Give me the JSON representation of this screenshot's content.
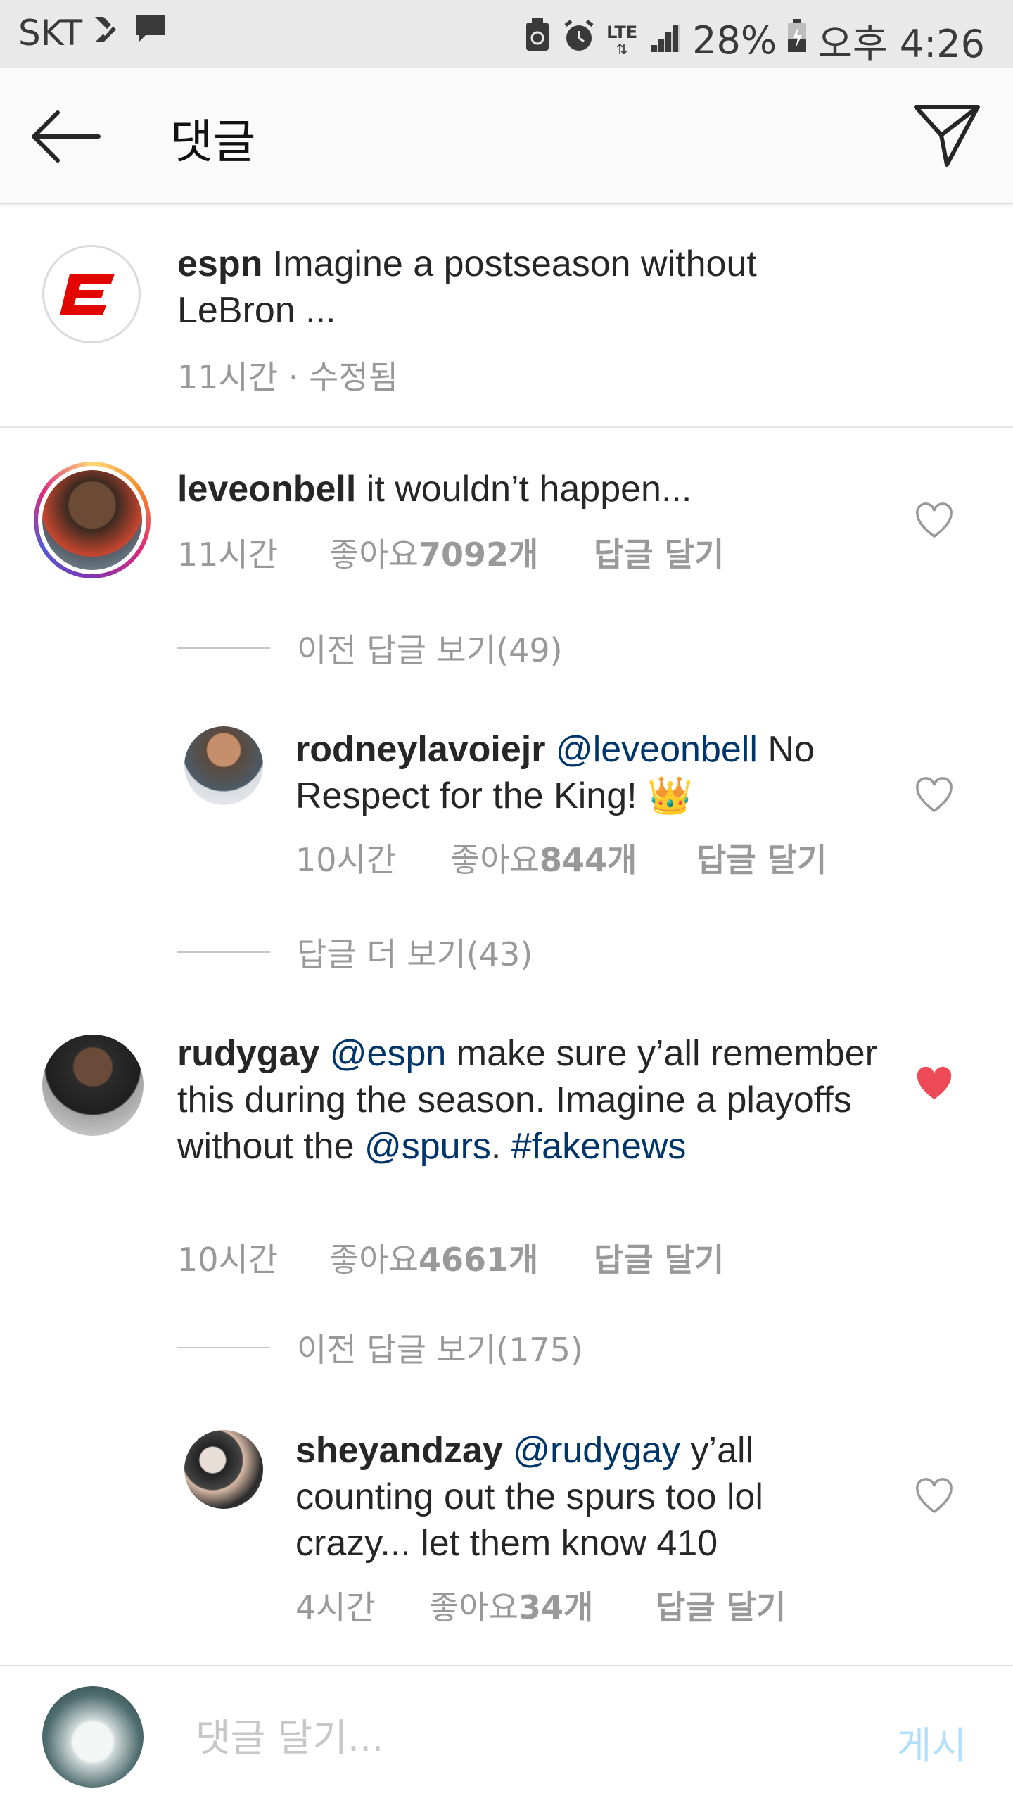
{
  "status_bar": {
    "carrier": "SKT",
    "lte": "LTE",
    "battery": "28%",
    "time": "오후 4:26"
  },
  "app_bar": {
    "title": "댓글"
  },
  "caption": {
    "username": "espn",
    "text": "Imagine a postseason without LeBron ...",
    "meta": "11시간 · 수정됨"
  },
  "comments": [
    {
      "username": "leveonbell",
      "text": "it wouldn’t happen...",
      "time": "11시간",
      "likes_prefix": "좋아요 ",
      "likes": "7092개",
      "reply": "답글 달기",
      "liked": false
    },
    {
      "username": "rodneylavoiejr",
      "mention": "@leveonbell",
      "text": "No Respect for the King! 👑",
      "time": "10시간",
      "likes_prefix": "좋아요 ",
      "likes": "844개",
      "reply": "답글 달기",
      "liked": false
    },
    {
      "username": "rudygay",
      "mention": "@espn",
      "text1": "make sure y’all remember this during the season. Imagine a playoffs without the",
      "mention2": "@spurs",
      "text2": ".",
      "hashtag": "#fakenews",
      "time": "10시간",
      "likes_prefix": "좋아요 ",
      "likes": "4661개",
      "reply": "답글 달기",
      "liked": true
    },
    {
      "username": "sheyandzay",
      "mention": "@rudygay",
      "text": "y’all counting out the spurs too lol crazy... let them know 410",
      "time": "4시간",
      "likes_prefix": "좋아요 ",
      "likes": "34개",
      "reply": "답글 달기",
      "liked": false
    }
  ],
  "view_more": [
    "이전 답글 보기(49)",
    "답글 더 보기(43)",
    "이전 답글 보기(175)"
  ],
  "composer": {
    "placeholder": "댓글 달기...",
    "post_label": "게시"
  },
  "colors": {
    "mention": "#003569",
    "heart_liked": "#ed4956",
    "post_disabled": "#b2dffc"
  }
}
